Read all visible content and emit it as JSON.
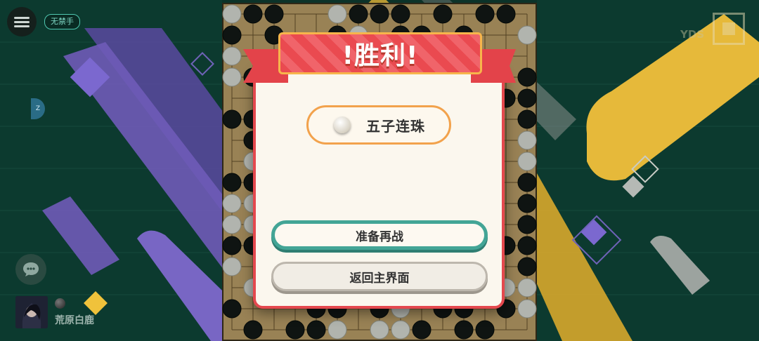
{
  "top_bar": {
    "menu_icon": "hamburger-menu-icon",
    "rule_badge": "无禁手"
  },
  "dialog": {
    "title": "!胜利!",
    "result_stone": "white-stone",
    "result_text": "五子连珠",
    "rematch_label": "准备再战",
    "back_label": "返回主界面"
  },
  "player": {
    "name": "荒原白鹿",
    "stone": "black-stone"
  },
  "side_badge": "Z",
  "right_logo": "YDS",
  "colors": {
    "background": "#0d3b30",
    "banner_red": "#e4484e",
    "accent_teal": "#43a596",
    "pill_orange": "#f2a24c",
    "confetti_purple": "#6f5bb8",
    "confetti_yellow": "#f0c23b"
  }
}
